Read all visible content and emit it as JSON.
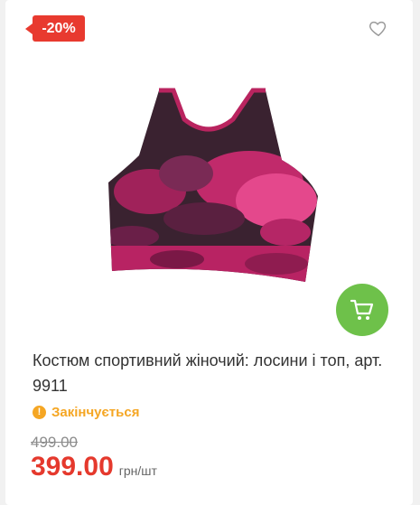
{
  "product": {
    "discount_badge": "-20%",
    "title": "Костюм спортивний жіночий: лосини і топ, арт. 9911",
    "status": "Закінчується",
    "old_price": "499.00",
    "price": "399.00",
    "unit": "грн/шт",
    "image_alt": "tie-dye sports bra top"
  },
  "icons": {
    "favorite": "heart-outline-icon",
    "cart": "cart-icon",
    "status": "warning-icon"
  },
  "colors": {
    "badge": "#e83a2f",
    "cart_button": "#6ec14a",
    "status": "#f5a623",
    "price": "#e5392d"
  }
}
